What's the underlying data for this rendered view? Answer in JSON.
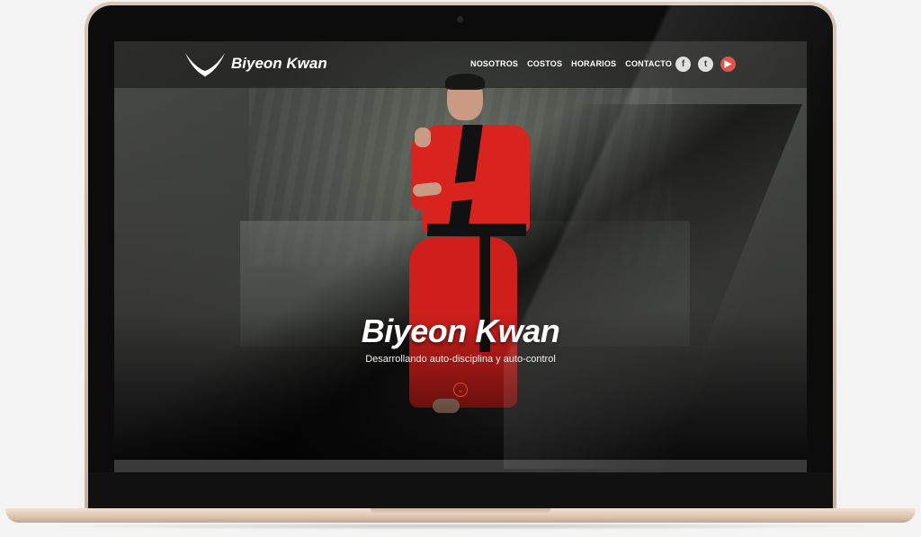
{
  "brand": {
    "name": "Biyeon Kwan"
  },
  "nav": {
    "items": [
      {
        "label": "NOSOTROS"
      },
      {
        "label": "COSTOS"
      },
      {
        "label": "HORARIOS"
      },
      {
        "label": "CONTACTO"
      }
    ]
  },
  "social": {
    "items": [
      {
        "icon": "facebook-icon",
        "glyph": "f"
      },
      {
        "icon": "twitter-icon",
        "glyph": "t"
      },
      {
        "icon": "youtube-icon",
        "glyph": "▶"
      }
    ]
  },
  "hero": {
    "title": "Biyeon Kwan",
    "subtitle": "Desarrollando auto-disciplina y auto-control",
    "scroll_icon": "chevron-down-icon",
    "scroll_glyph": "⌄"
  },
  "colors": {
    "accent": "#e1483b",
    "gi_red": "#d8231f",
    "frame_gold": "#d9c6b4"
  }
}
